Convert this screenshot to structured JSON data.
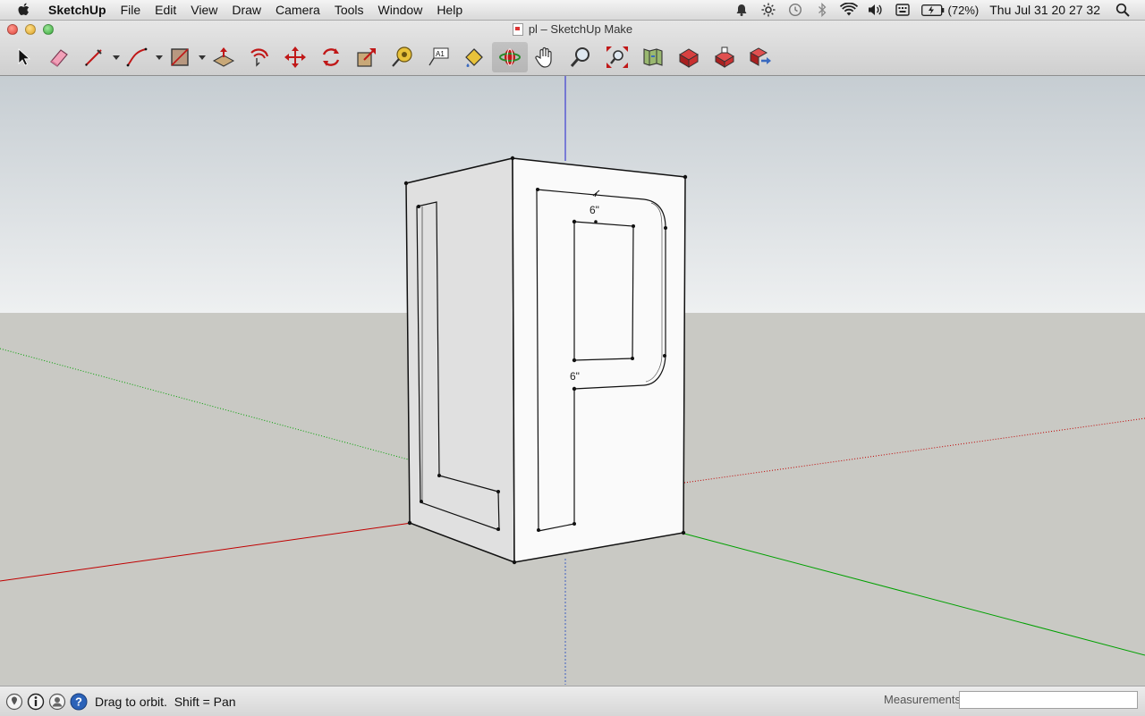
{
  "menubar": {
    "app_name": "SketchUp",
    "items": [
      "File",
      "Edit",
      "View",
      "Draw",
      "Camera",
      "Tools",
      "Window",
      "Help"
    ],
    "battery": "(72%)",
    "clock": "Thu Jul 31  20 27 32"
  },
  "window": {
    "title": "pl – SketchUp Make"
  },
  "toolbar": {
    "tools": [
      "select",
      "eraser",
      "pencil",
      "arc",
      "rectangle",
      "push-pull",
      "offset",
      "move",
      "rotate",
      "scale",
      "tape-measure",
      "text",
      "paint-bucket",
      "orbit",
      "pan",
      "zoom",
      "zoom-extents",
      "previous-view",
      "3d-warehouse",
      "extension-warehouse",
      "share-model"
    ],
    "active_tool": "orbit"
  },
  "viewport": {
    "dimension_top": "6\"",
    "dimension_middle": "6\"",
    "colors": {
      "sky": "#c8cfd4",
      "ground": "#c9c9c4",
      "red_axis": "#cc0000",
      "green_axis": "#00aa00",
      "blue_axis": "#0000cc"
    }
  },
  "statusbar": {
    "message": "Drag to orbit.  Shift = Pan",
    "measurements_label": "Measurements",
    "measurements_value": ""
  }
}
